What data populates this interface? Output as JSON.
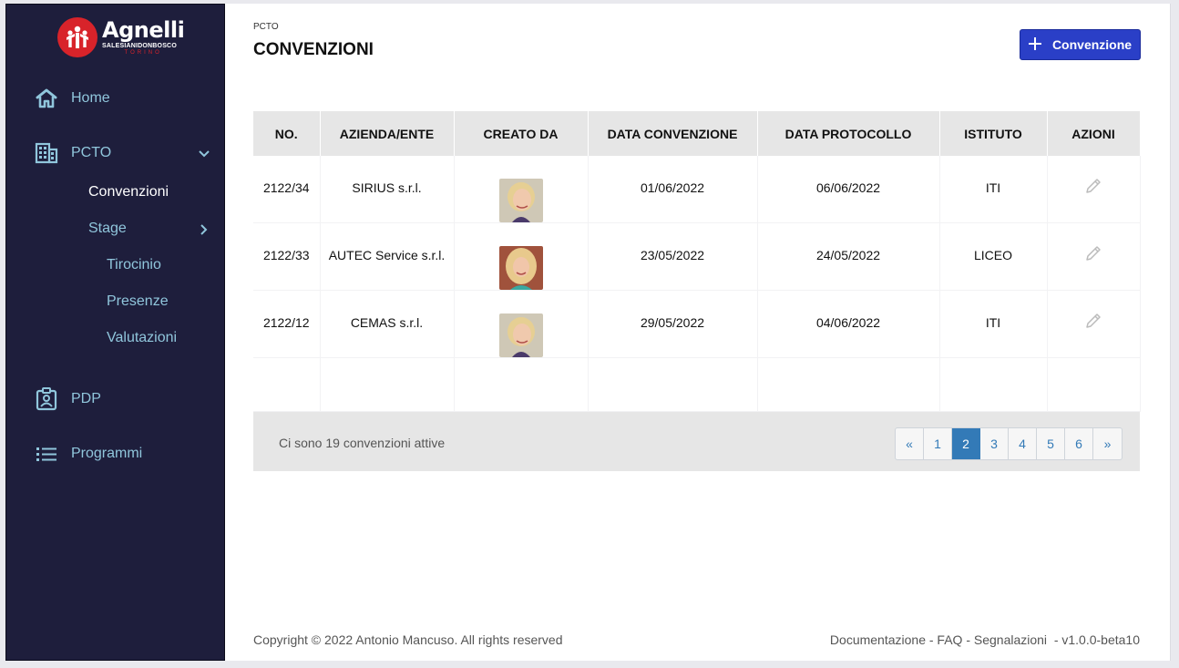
{
  "brand": {
    "title": "Agnelli",
    "subtitle": "SALESIANIDONBOSCO",
    "city": "TORINO"
  },
  "sidebar": {
    "items": [
      {
        "label": "Home",
        "icon": "home-icon"
      },
      {
        "label": "PCTO",
        "icon": "building-icon",
        "expanded": true
      },
      {
        "label": "PDP",
        "icon": "id-badge-icon"
      },
      {
        "label": "Programmi",
        "icon": "list-icon"
      }
    ],
    "pcto_sub": [
      {
        "label": "Convenzioni",
        "active": true
      },
      {
        "label": "Stage"
      }
    ],
    "stage_sub": [
      {
        "label": "Tirocinio"
      },
      {
        "label": "Presenze"
      },
      {
        "label": "Valutazioni"
      }
    ]
  },
  "header": {
    "breadcrumb": "PCTO",
    "title": "CONVENZIONI",
    "add_button": "Convenzione"
  },
  "table": {
    "columns": [
      "NO.",
      "AZIENDA/ENTE",
      "CREATO DA",
      "DATA CONVENZIONE",
      "DATA PROTOCOLLO",
      "ISTITUTO",
      "AZIONI"
    ],
    "rows": [
      {
        "no": "2122/34",
        "azienda": "SIRIUS s.r.l.",
        "avatar": "avatar-woman-blonde-short",
        "data_convenzione": "01/06/2022",
        "data_protocollo": "06/06/2022",
        "istituto": "ITI"
      },
      {
        "no": "2122/33",
        "azienda": "AUTEC Service s.r.l.",
        "avatar": "avatar-woman-blonde-long",
        "data_convenzione": "23/05/2022",
        "data_protocollo": "24/05/2022",
        "istituto": "LICEO"
      },
      {
        "no": "2122/12",
        "azienda": "CEMAS s.r.l.",
        "avatar": "avatar-woman-blonde-short",
        "data_convenzione": "29/05/2022",
        "data_protocollo": "04/06/2022",
        "istituto": "ITI"
      }
    ],
    "footer_text": "Ci sono 19 convenzioni attive",
    "pagination": [
      "«",
      "1",
      "2",
      "3",
      "4",
      "5",
      "6",
      "»"
    ],
    "current_page": "2"
  },
  "footer": {
    "copyright": "Copyright © 2022 Antonio Mancuso. All rights reserved",
    "links": "Documentazione - FAQ - Segnalazioni  - v1.0.0-beta10"
  },
  "colors": {
    "sidebar_bg": "#1e1e3c",
    "sidebar_text": "#90c6dc",
    "accent_button": "#2a3fc7",
    "pagination_active": "#337ab7",
    "logo_red": "#d8232a"
  }
}
